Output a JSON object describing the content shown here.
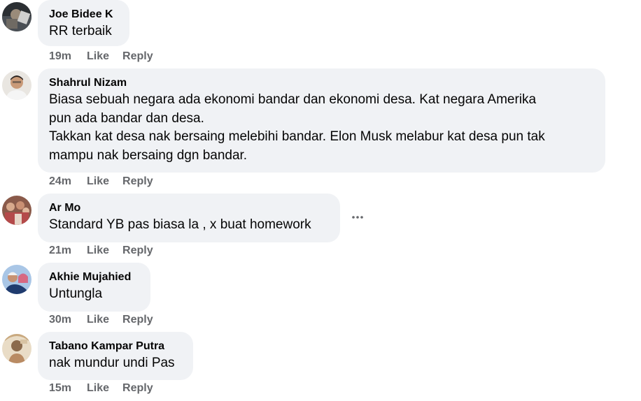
{
  "comments": [
    {
      "author": "Joe Bidee K",
      "text": "RR terbaik",
      "time": "19m",
      "like": "Like",
      "reply": "Reply"
    },
    {
      "author": "Shahrul Nizam",
      "text": "Biasa sebuah negara ada ekonomi bandar dan ekonomi desa. Kat negara Amerika\npun ada bandar dan desa.\nTakkan kat desa nak bersaing melebihi bandar. Elon Musk melabur kat desa pun tak\nmampu nak bersaing dgn bandar.",
      "time": "24m",
      "like": "Like",
      "reply": "Reply"
    },
    {
      "author": "Ar Mo",
      "text": "Standard YB pas biasa la , x buat homework",
      "time": "21m",
      "like": "Like",
      "reply": "Reply",
      "more_icon": "more-horizontal-icon"
    },
    {
      "author": "Akhie Mujahied",
      "text": "Untungla",
      "time": "30m",
      "like": "Like",
      "reply": "Reply"
    },
    {
      "author": "Tabano Kampar Putra",
      "text": "nak mundur undi Pas",
      "time": "15m",
      "like": "Like",
      "reply": "Reply"
    }
  ],
  "colors": {
    "bubble": "#f0f2f5",
    "text": "#050505",
    "secondary": "#65676b"
  }
}
